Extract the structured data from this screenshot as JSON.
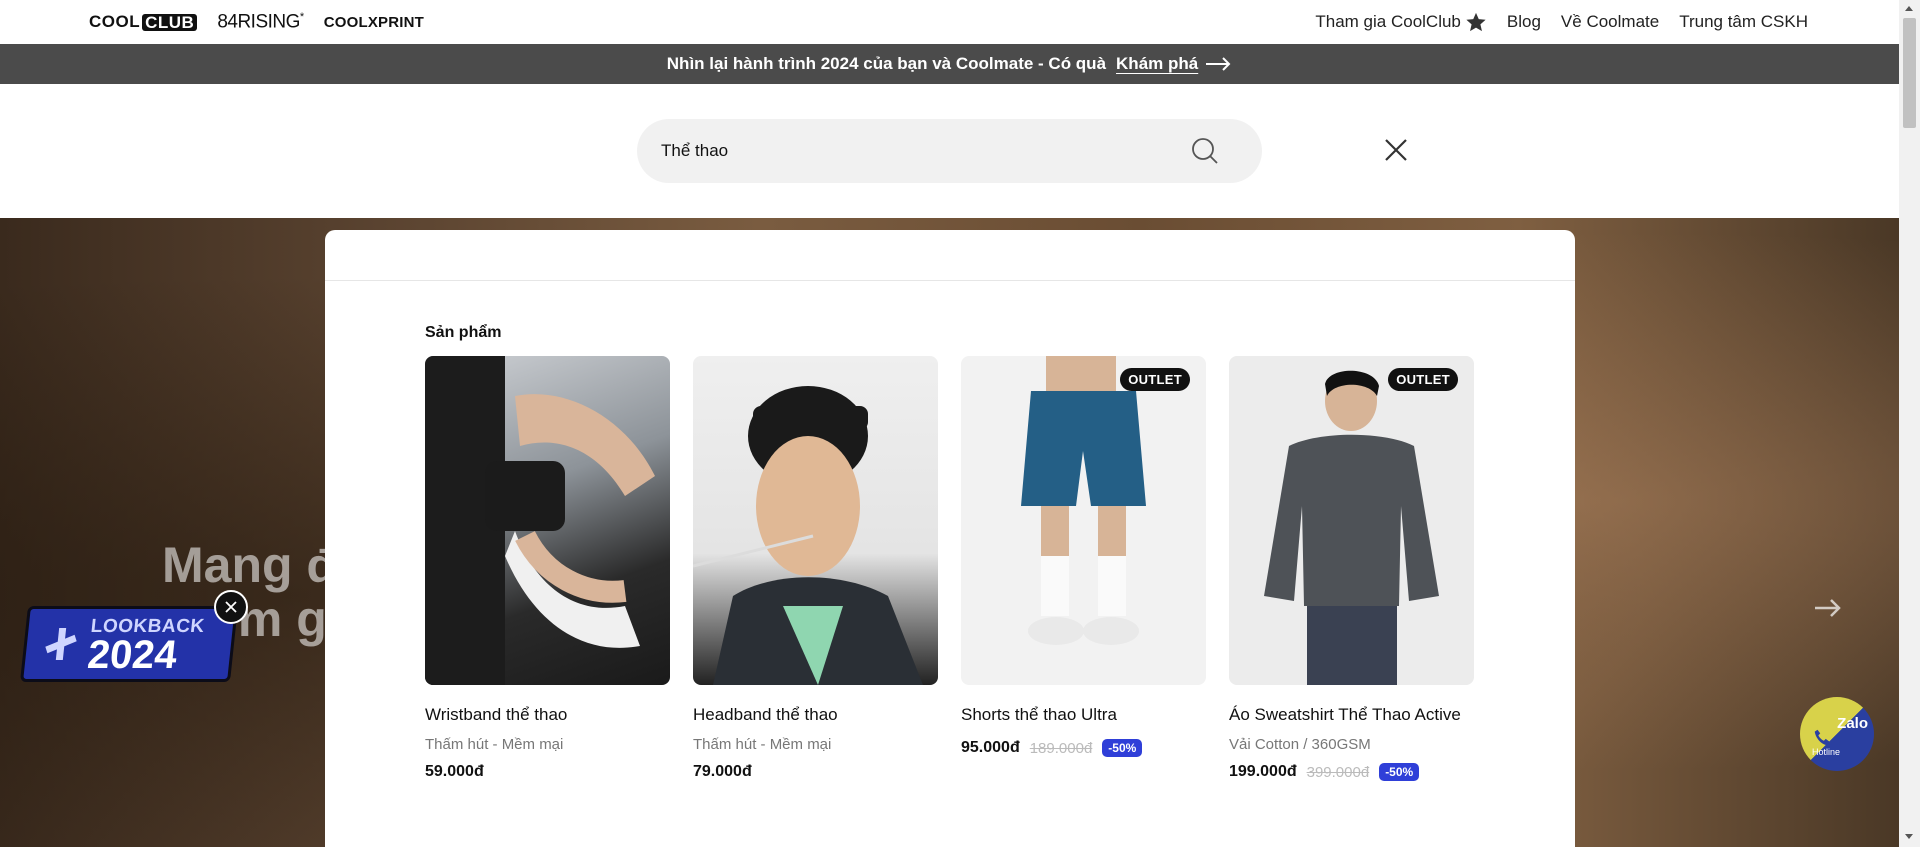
{
  "topbar": {
    "brands": {
      "coolclub_prefix": "COOL",
      "coolclub_suffix": "CLUB",
      "rising": "84RISING",
      "rising_mark": "*",
      "coolxprint": "COOLXPRINT"
    },
    "nav": [
      "Tham gia CoolClub",
      "Blog",
      "Về Coolmate",
      "Trung tâm CSKH"
    ]
  },
  "promo": {
    "text": "Nhìn lại hành trình 2024 của bạn và Coolmate - Có quà",
    "cta": "Khám phá"
  },
  "search": {
    "value": "Thể thao"
  },
  "hero": {
    "text_line1": "Mang đ",
    "text_line2": "ím g"
  },
  "lookback": {
    "top": "LOOKBACK",
    "year": "2024"
  },
  "hotline": {
    "zalo": "Zalo",
    "label": "Hotline"
  },
  "results": {
    "section_title": "Sản phẩm",
    "products": [
      {
        "name": "Wristband thể thao",
        "desc": "Thấm hút - Mềm mại",
        "price": "59.000đ",
        "old_price": "",
        "discount": "",
        "badge": ""
      },
      {
        "name": "Headband thể thao",
        "desc": "Thấm hút - Mềm mại",
        "price": "79.000đ",
        "old_price": "",
        "discount": "",
        "badge": ""
      },
      {
        "name": "Shorts thể thao Ultra",
        "desc": "",
        "price": "95.000đ",
        "old_price": "189.000đ",
        "discount": "-50%",
        "badge": "OUTLET"
      },
      {
        "name": "Áo Sweatshirt Thể Thao Active",
        "desc": "Vải Cotton / 360GSM",
        "price": "199.000đ",
        "old_price": "399.000đ",
        "discount": "-50%",
        "badge": "OUTLET"
      }
    ]
  },
  "colors": {
    "promo_bg": "#4b4b4b",
    "discount": "#2f3fd8",
    "lookback": "#2332a8"
  }
}
